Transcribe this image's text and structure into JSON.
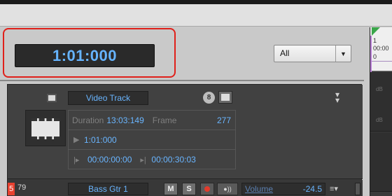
{
  "transport": {
    "time_display": "1:01:000",
    "filter_select": {
      "value": "All"
    }
  },
  "video_track": {
    "name": "Video Track",
    "badge": "8",
    "duration_label": "Duration",
    "duration_value": "13:03:149",
    "frame_label": "Frame",
    "frame_value": "277",
    "position": "1:01:000",
    "in_time": "00:00:00:00",
    "out_time": "00:00:30:03"
  },
  "audio_track": {
    "number": "5",
    "number2": "79",
    "name": "Bass Gtr 1",
    "mute_label": "M",
    "solo_label": "S",
    "volume_label": "Volume",
    "volume_value": "-24.5"
  },
  "timeline": {
    "bar": "1",
    "time": "00:00",
    "zero": "0",
    "db_label": "dB"
  },
  "icons": [
    "film-icon",
    "triangle-play-icon",
    "in-point-icon",
    "out-point-icon",
    "record-icon",
    "monitor-icon",
    "menu-icon",
    "collapse-icon",
    "chevron-down-icon"
  ],
  "colors": {
    "accent_blue": "#69b5ff",
    "highlight_red": "#e0201a",
    "track_number": "#e8412f",
    "marker_green": "#3aa64a"
  }
}
